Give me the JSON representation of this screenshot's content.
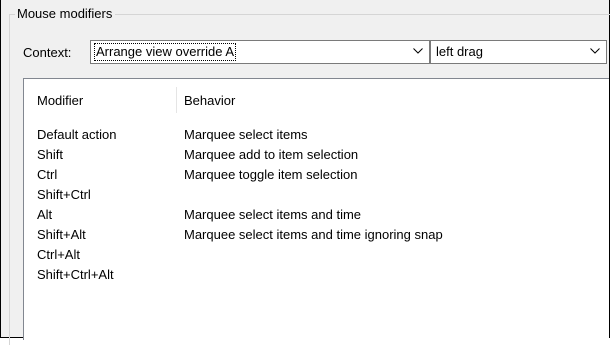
{
  "group": {
    "title": "Mouse modifiers"
  },
  "context": {
    "label": "Context:",
    "selected_context": "Arrange view override A",
    "selected_action": "left drag"
  },
  "icons": {
    "dropdown": "chevron-down-icon"
  },
  "colors": {
    "panel": "#f0f0f0",
    "list_background": "#ffffff",
    "border": "#7a7a7a"
  },
  "table": {
    "columns": [
      "Modifier",
      "Behavior"
    ],
    "rows": [
      {
        "modifier": "Default action",
        "behavior": "Marquee select items"
      },
      {
        "modifier": "Shift",
        "behavior": "Marquee add to item selection"
      },
      {
        "modifier": "Ctrl",
        "behavior": "Marquee toggle item selection"
      },
      {
        "modifier": "Shift+Ctrl",
        "behavior": ""
      },
      {
        "modifier": "Alt",
        "behavior": "Marquee select items and time"
      },
      {
        "modifier": "Shift+Alt",
        "behavior": "Marquee select items and time ignoring snap"
      },
      {
        "modifier": "Ctrl+Alt",
        "behavior": ""
      },
      {
        "modifier": "Shift+Ctrl+Alt",
        "behavior": ""
      }
    ]
  }
}
